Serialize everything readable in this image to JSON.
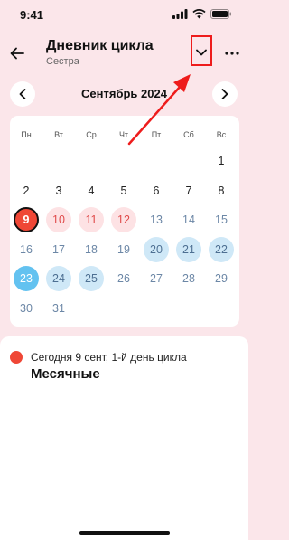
{
  "status_bar": {
    "time": "9:41",
    "icons": [
      "signal-icon",
      "wifi-icon",
      "battery-icon"
    ]
  },
  "header": {
    "title": "Дневник цикла",
    "subtitle": "Сестра",
    "icons": {
      "back": "arrow-left-icon",
      "dropdown": "chevron-down-icon",
      "more": "more-horizontal-icon"
    }
  },
  "calendar": {
    "month": "Сентябрь 2024",
    "weekdays": [
      "Пн",
      "Вт",
      "Ср",
      "Чт",
      "Пт",
      "Сб",
      "Вс"
    ],
    "weeks": [
      [
        "",
        "",
        "",
        "",
        "",
        "",
        "1"
      ],
      [
        "2",
        "3",
        "4",
        "5",
        "6",
        "7",
        "8"
      ],
      [
        "9",
        "10",
        "11",
        "12",
        "13",
        "14",
        "15"
      ],
      [
        "16",
        "17",
        "18",
        "19",
        "20",
        "21",
        "22"
      ],
      [
        "23",
        "24",
        "25",
        "26",
        "27",
        "28",
        "29"
      ],
      [
        "30",
        "31",
        "",
        "",
        "",
        "",
        ""
      ]
    ],
    "today": "9",
    "period_days": [
      "10",
      "11",
      "12"
    ],
    "fertile_days": [
      "20",
      "21",
      "22",
      "24",
      "25"
    ],
    "ovulation_day": "23"
  },
  "info": {
    "cycle_text": "Сегодня 9 сент, 1-й день цикла",
    "phase": "Месячные"
  },
  "colors": {
    "background": "#fbe6ea",
    "accent_red": "#ef4736",
    "period_bg": "#fde2e4",
    "fertile_bg": "#cfe8f7",
    "ovulation_bg": "#63c2f0",
    "annotation": "#ee1c1c"
  }
}
